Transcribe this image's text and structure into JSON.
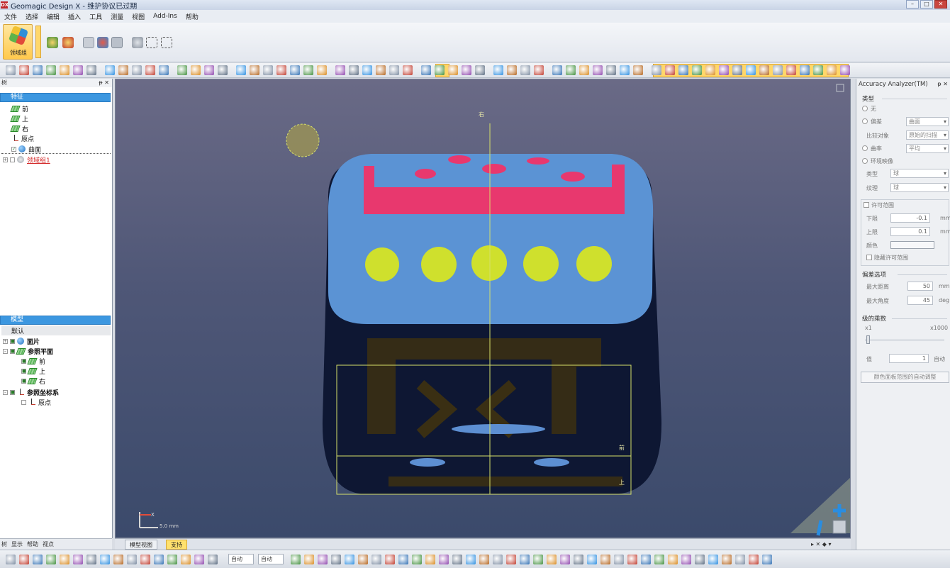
{
  "window": {
    "app_badge": "DX",
    "title": "Geomagic Design X - 维护协议已过期",
    "btn_min": "–",
    "btn_max": "□",
    "btn_close": "✕"
  },
  "menu": [
    "文件",
    "选择",
    "编辑",
    "插入",
    "工具",
    "测量",
    "视图",
    "Add-Ins",
    "帮助"
  ],
  "ribbon": {
    "region_group_label": "领域组"
  },
  "feature_tree": {
    "header": "树",
    "pin": "ᵽ ✕",
    "root": "特征",
    "items": [
      "前",
      "上",
      "右",
      "原点",
      "曲面",
      "领域组1"
    ]
  },
  "model_tree": {
    "root": "模型",
    "default": "默认",
    "items": [
      "面片",
      "参照平面",
      "前",
      "上",
      "右",
      "参照坐标系",
      "原点"
    ]
  },
  "left_tabs": [
    "树",
    "显示",
    "帮助",
    "视点"
  ],
  "viewport": {
    "label_top": "右",
    "label_front": "前",
    "label_up": "上",
    "triad_x": "X",
    "scale_text": "5.0 mm"
  },
  "view_tabs": {
    "model_view": "模型视图",
    "support": "支持",
    "nav": "▸ ✕ ◆ ▾"
  },
  "accuracy_analyzer": {
    "title": "Accuracy Analyzer(TM)",
    "pin": "ᵽ ✕",
    "type_section": "类型",
    "opt_none": "无",
    "opt_deviation": "偏差",
    "deviation_value": "曲面",
    "compare_label": "比较对象",
    "compare_value": "原始的扫描",
    "opt_curvature": "曲率",
    "curvature_value": "平均",
    "opt_env": "环境映像",
    "type_label": "类型",
    "type_value": "球",
    "texture_label": "纹理",
    "texture_value": "球",
    "tolerance_section": "许可范围",
    "lower_label": "下限",
    "lower_value": "-0.1",
    "upper_label": "上限",
    "upper_value": "0.1",
    "unit_mm": "mm",
    "color_label": "颜色",
    "hide_tol": "隐藏许可范围",
    "deviation_options": "偏差选项",
    "max_dist_label": "最大距离",
    "max_dist_value": "50",
    "max_angle_label": "最大角度",
    "max_angle_value": "45",
    "unit_deg": "deg",
    "multiplier_section": "级的乘数",
    "mult_min": "x1",
    "mult_max": "x1000",
    "value_label": "值",
    "value_value": "1",
    "auto_label": "自动",
    "auto_adjust": "颜色面板范围的自动调整"
  },
  "statusbar": {
    "drop1": "自动",
    "drop2": "自动"
  }
}
